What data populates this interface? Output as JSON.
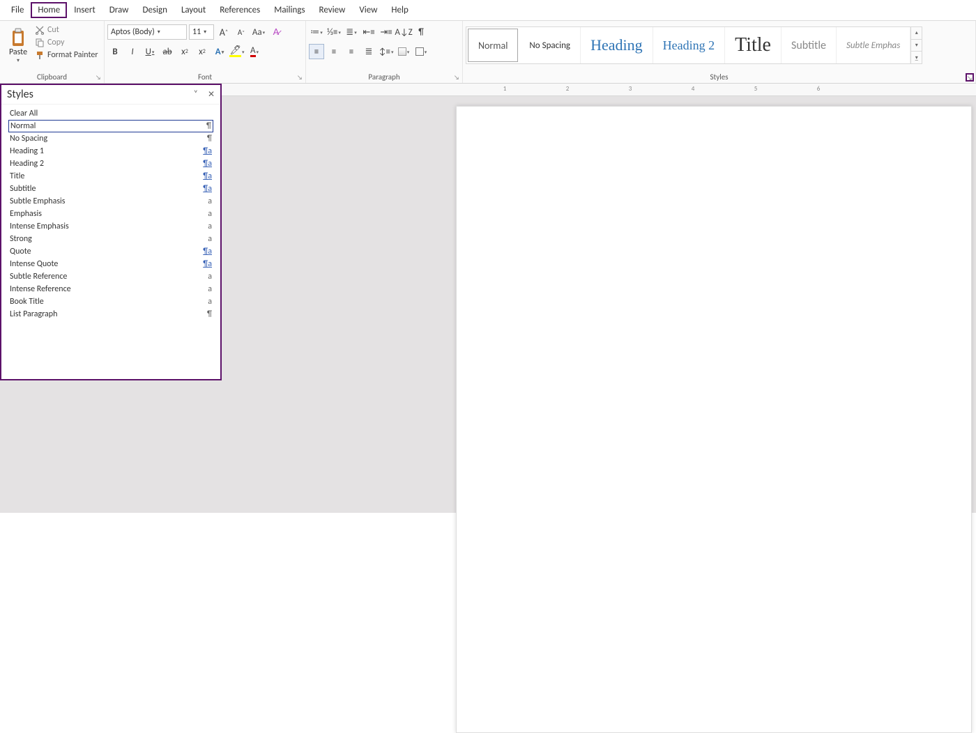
{
  "menu": [
    "File",
    "Home",
    "Insert",
    "Draw",
    "Design",
    "Layout",
    "References",
    "Mailings",
    "Review",
    "View",
    "Help"
  ],
  "active_tab": "Home",
  "clipboard": {
    "paste": "Paste",
    "cut": "Cut",
    "copy": "Copy",
    "format_painter": "Format Painter",
    "label": "Clipboard"
  },
  "font": {
    "name": "Aptos (Body)",
    "size": "11",
    "label": "Font"
  },
  "paragraph": {
    "label": "Paragraph"
  },
  "styles": {
    "label": "Styles",
    "gallery": [
      {
        "label": "Normal",
        "cls": "swatch-normal"
      },
      {
        "label": "No Spacing",
        "cls": ""
      },
      {
        "label": "Heading 1",
        "display": "Heading",
        "cls": "swatch-heading1"
      },
      {
        "label": "Heading 2",
        "display": "Heading 2",
        "cls": "swatch-heading2"
      },
      {
        "label": "Title",
        "display": "Title",
        "cls": "swatch-title"
      },
      {
        "label": "Subtitle",
        "display": "Subtitle",
        "cls": "swatch-subtitle"
      },
      {
        "label": "Subtle Emphasis",
        "display": "Subtle Emphas",
        "cls": "swatch-subemph"
      }
    ]
  },
  "styles_pane": {
    "title": "Styles",
    "clear": "Clear All",
    "items": [
      {
        "name": "Normal",
        "sym": "¶",
        "selected": true
      },
      {
        "name": "No Spacing",
        "sym": "¶"
      },
      {
        "name": "Heading 1",
        "sym": "¶a",
        "link": true
      },
      {
        "name": "Heading 2",
        "sym": "¶a",
        "link": true
      },
      {
        "name": "Title",
        "sym": "¶a",
        "link": true
      },
      {
        "name": "Subtitle",
        "sym": "¶a",
        "link": true
      },
      {
        "name": "Subtle Emphasis",
        "sym": "a"
      },
      {
        "name": "Emphasis",
        "sym": "a"
      },
      {
        "name": "Intense Emphasis",
        "sym": "a"
      },
      {
        "name": "Strong",
        "sym": "a"
      },
      {
        "name": "Quote",
        "sym": "¶a",
        "link": true
      },
      {
        "name": "Intense Quote",
        "sym": "¶a",
        "link": true
      },
      {
        "name": "Subtle Reference",
        "sym": "a"
      },
      {
        "name": "Intense Reference",
        "sym": "a"
      },
      {
        "name": "Book Title",
        "sym": "a"
      },
      {
        "name": "List Paragraph",
        "sym": "¶"
      }
    ]
  },
  "ruler_numbers": [
    1,
    2,
    3,
    4,
    5,
    6
  ]
}
